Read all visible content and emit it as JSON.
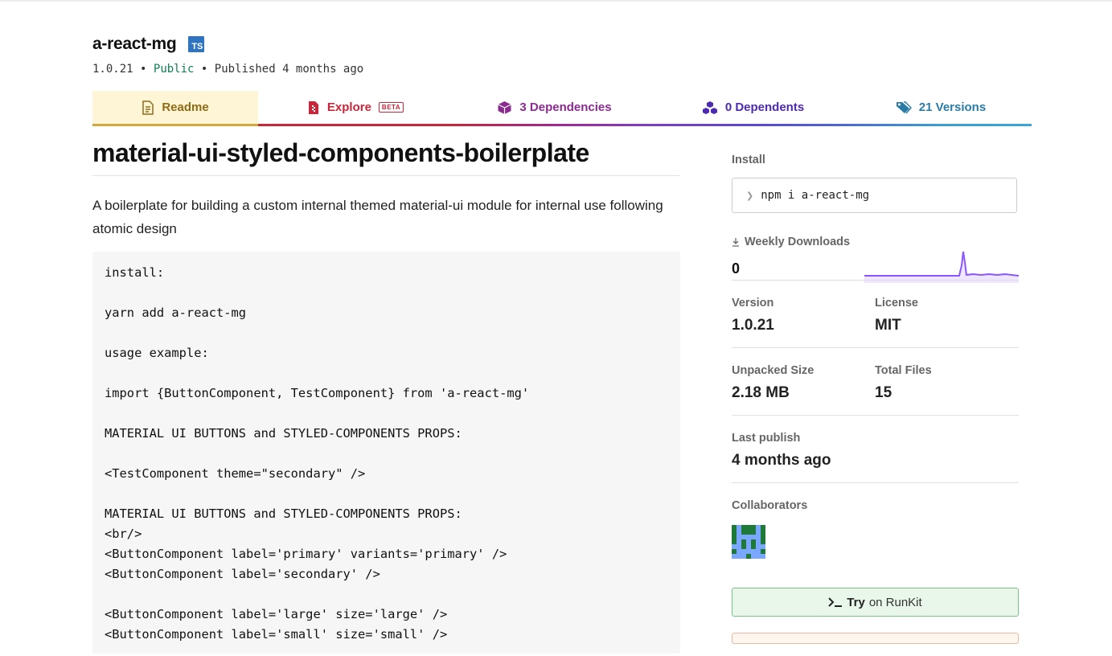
{
  "package": {
    "name": "a-react-mg",
    "ts_badge": "TS",
    "version": "1.0.21",
    "visibility": "Public",
    "published": "Published 4 months ago",
    "separator": "•"
  },
  "tabs": [
    {
      "label": "Readme",
      "icon": "readme-icon"
    },
    {
      "label": "Explore",
      "icon": "explore-icon",
      "badge": "BETA"
    },
    {
      "label": "3 Dependencies",
      "icon": "box-icon"
    },
    {
      "label": "0 Dependents",
      "icon": "boxes-icon"
    },
    {
      "label": "21 Versions",
      "icon": "tags-icon"
    }
  ],
  "readme": {
    "title": "material-ui-styled-components-boilerplate",
    "description": "A boilerplate for building a custom internal themed material-ui module for internal use following atomic design",
    "code": "install:\n\nyarn add a-react-mg\n\nusage example:\n\nimport {ButtonComponent, TestComponent} from 'a-react-mg'\n\nMATERIAL UI BUTTONS and STYLED-COMPONENTS PROPS:\n\n<TestComponent theme=\"secondary\" />\n\nMATERIAL UI BUTTONS and STYLED-COMPONENTS PROPS:\n<br/>\n<ButtonComponent label='primary' variants='primary' />\n<ButtonComponent label='secondary' />\n\n<ButtonComponent label='large' size='large' />\n<ButtonComponent label='small' size='small' />"
  },
  "sidebar": {
    "install_label": "Install",
    "install_cmd": "npm i a-react-mg",
    "weekly_downloads_label": "Weekly Downloads",
    "weekly_downloads": "0",
    "version_label": "Version",
    "version": "1.0.21",
    "license_label": "License",
    "license": "MIT",
    "unpacked_size_label": "Unpacked Size",
    "unpacked_size": "2.18 MB",
    "total_files_label": "Total Files",
    "total_files": "15",
    "last_publish_label": "Last publish",
    "last_publish": "4 months ago",
    "collaborators_label": "Collaborators",
    "runkit_try": "Try",
    "runkit_rest": "on RunKit"
  },
  "colors": {
    "sparkline": "#8956ff",
    "public": "#0e7f54"
  }
}
